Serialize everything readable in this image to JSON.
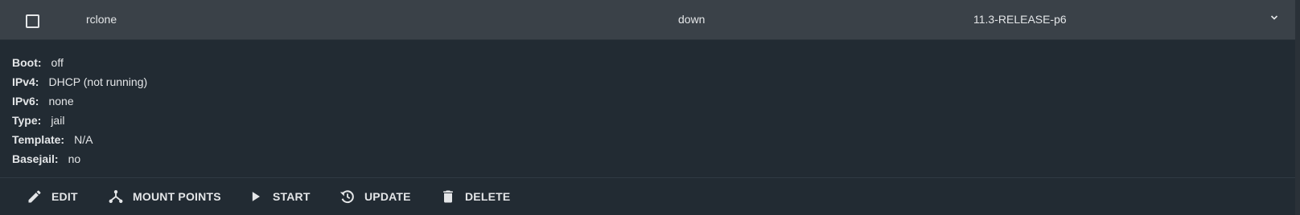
{
  "row": {
    "name": "rclone",
    "state": "down",
    "release": "11.3-RELEASE-p6"
  },
  "details": [
    {
      "label": "Boot:",
      "value": "off"
    },
    {
      "label": "IPv4:",
      "value": "DHCP (not running)"
    },
    {
      "label": "IPv6:",
      "value": "none"
    },
    {
      "label": "Type:",
      "value": "jail"
    },
    {
      "label": "Template:",
      "value": "N/A"
    },
    {
      "label": "Basejail:",
      "value": "no"
    }
  ],
  "actions": {
    "edit": {
      "label": "EDIT",
      "icon": "pencil-icon"
    },
    "mount": {
      "label": "MOUNT POINTS",
      "icon": "fork-icon"
    },
    "start": {
      "label": "START",
      "icon": "play-icon"
    },
    "update": {
      "label": "UPDATE",
      "icon": "history-icon"
    },
    "delete": {
      "label": "DELETE",
      "icon": "trash-icon"
    }
  },
  "colors": {
    "background": "#222b33",
    "header": "#3a4148",
    "text": "#e4e6e8"
  }
}
